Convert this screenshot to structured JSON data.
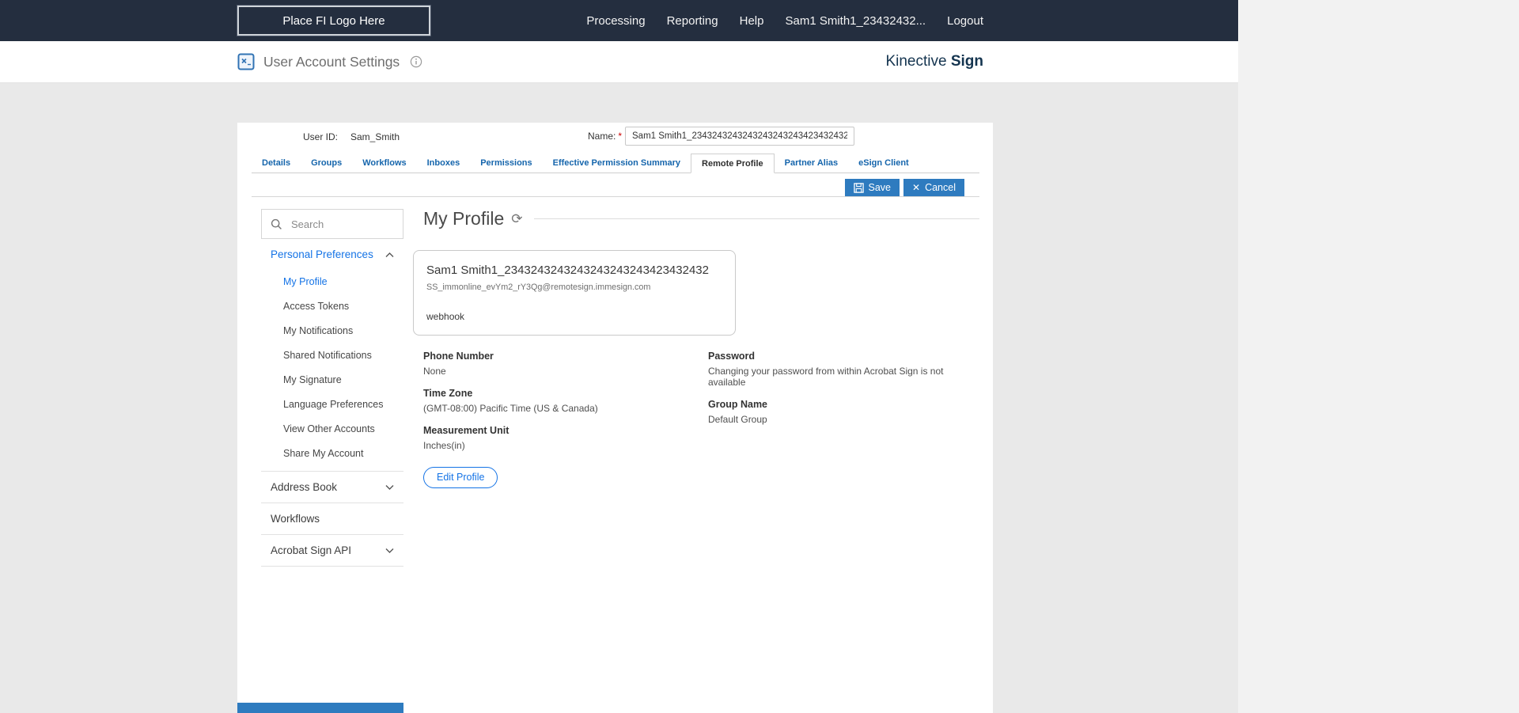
{
  "colors": {
    "topbar_bg": "#242e3f",
    "accent_blue": "#1473e6",
    "tab_blue": "#1565ac",
    "action_button_blue": "#2e7bbf",
    "brand_navy": "#14344f"
  },
  "topbar": {
    "logo_placeholder": "Place FI Logo Here",
    "nav": [
      "Processing",
      "Reporting",
      "Help",
      "Sam1 Smith1_23432432...",
      "Logout"
    ]
  },
  "header": {
    "title": "User Account Settings",
    "brand_regular": "Kinective",
    "brand_bold": "Sign"
  },
  "user_form": {
    "user_id_label": "User ID:",
    "user_id_value": "Sam_Smith",
    "name_label": "Name:",
    "required_mark": "*",
    "name_value": "Sam1 Smith1_2343243243243243243243423432432"
  },
  "tabs": [
    {
      "label": "Details"
    },
    {
      "label": "Groups"
    },
    {
      "label": "Workflows"
    },
    {
      "label": "Inboxes"
    },
    {
      "label": "Permissions"
    },
    {
      "label": "Effective Permission Summary"
    },
    {
      "label": "Remote Profile",
      "active": true
    },
    {
      "label": "Partner Alias"
    },
    {
      "label": "eSign Client"
    }
  ],
  "actions": {
    "save": "Save",
    "cancel": "Cancel"
  },
  "sidebar": {
    "search_placeholder": "Search",
    "personal_preferences": {
      "label": "Personal Preferences",
      "selected_item": "My Profile",
      "items": [
        "My Profile",
        "Access Tokens",
        "My Notifications",
        "Shared Notifications",
        "My Signature",
        "Language Preferences",
        "View Other Accounts",
        "Share My Account"
      ]
    },
    "address_book_label": "Address Book",
    "workflows_label": "Workflows",
    "acrobat_sign_api_label": "Acrobat Sign API"
  },
  "profile": {
    "heading": "My Profile",
    "card": {
      "name": "Sam1 Smith1_2343243243243243243243423432432",
      "email": "SS_immonline_evYm2_rY3Qg@remotesign.immesign.com",
      "tag": "webhook"
    },
    "fields_left": [
      {
        "label": "Phone Number",
        "value": "None"
      },
      {
        "label": "Time Zone",
        "value": "(GMT-08:00) Pacific Time (US & Canada)"
      },
      {
        "label": "Measurement Unit",
        "value": "Inches(in)"
      }
    ],
    "fields_right": [
      {
        "label": "Password",
        "value": "Changing your password from within Acrobat Sign is not available"
      },
      {
        "label": "Group Name",
        "value": "Default Group"
      }
    ],
    "edit_button": "Edit Profile"
  }
}
